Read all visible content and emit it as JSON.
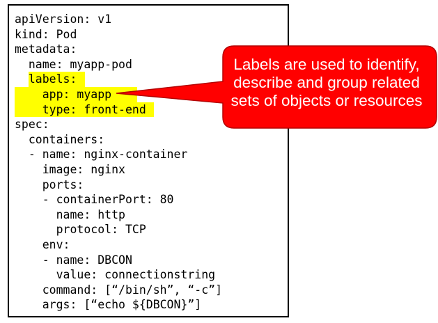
{
  "code": {
    "lines": [
      {
        "indent": "",
        "text": "apiVersion: v1"
      },
      {
        "indent": "",
        "text": "kind: Pod"
      },
      {
        "indent": "",
        "text": "metadata:"
      },
      {
        "indent": "  ",
        "text": "name: myapp-pod"
      },
      {
        "indent": "  ",
        "text": "labels:"
      },
      {
        "indent": "    ",
        "text": "app: myapp"
      },
      {
        "indent": "    ",
        "text": "type: front-end"
      },
      {
        "indent": "",
        "text": "spec:"
      },
      {
        "indent": "  ",
        "text": "containers:"
      },
      {
        "indent": "  ",
        "text": "- name: nginx-container"
      },
      {
        "indent": "    ",
        "text": "image: nginx"
      },
      {
        "indent": "    ",
        "text": "ports:"
      },
      {
        "indent": "    ",
        "text": "- containerPort: 80"
      },
      {
        "indent": "      ",
        "text": "name: http"
      },
      {
        "indent": "      ",
        "text": "protocol: TCP"
      },
      {
        "indent": "    ",
        "text": "env:"
      },
      {
        "indent": "    ",
        "text": "- name: DBCON"
      },
      {
        "indent": "      ",
        "text": "value: connectionstring"
      },
      {
        "indent": "    ",
        "text": "command: [“/bin/sh”, “-c”]"
      },
      {
        "indent": "    ",
        "text": "args: [“echo ${DBCON}”]"
      }
    ],
    "highlight_color": "#ffff00"
  },
  "callout": {
    "lines": [
      "Labels are used to identify,",
      "describe and group related",
      "sets of objects or resources"
    ],
    "fill_color": "#ff0000",
    "text_color": "#ffffff"
  }
}
